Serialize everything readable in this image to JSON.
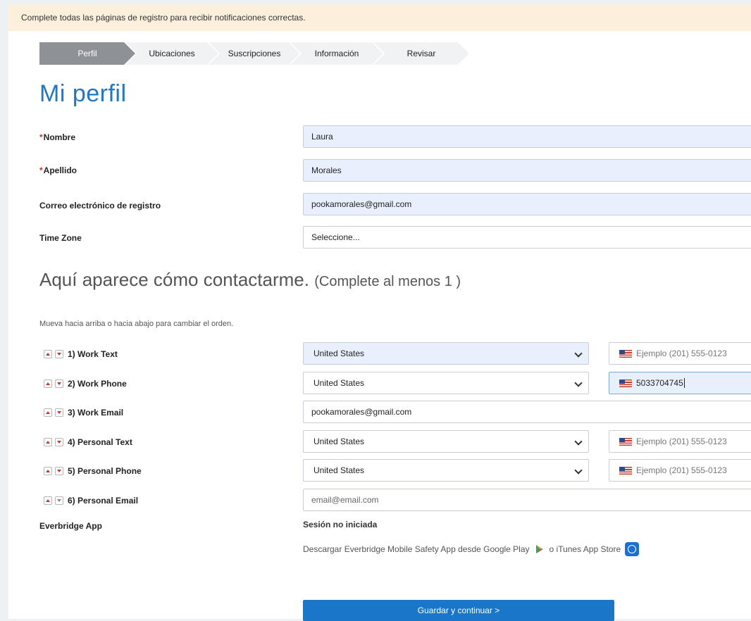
{
  "notice": "Complete todas las páginas de registro para recibir notificaciones correctas.",
  "steps": [
    {
      "label": "Perfil",
      "active": true
    },
    {
      "label": "Ubicaciones"
    },
    {
      "label": "Suscripciones"
    },
    {
      "label": "Información"
    },
    {
      "label": "Revisar"
    }
  ],
  "title": "Mi perfil",
  "profile": {
    "first_name_label": "Nombre",
    "first_name_value": "Laura",
    "last_name_label": "Apellido",
    "last_name_value": "Morales",
    "email_label": "Correo electrónico de registro",
    "email_value": "pookamorales@gmail.com",
    "timezone_label": "Time Zone",
    "timezone_value": "Seleccione..."
  },
  "contact": {
    "heading": "Aquí aparece cómo contactarme.",
    "heading_sub": "(Complete al menos 1 )",
    "hint": "Mueva hacia arriba o hacia abajo para cambiar el orden.",
    "rows": [
      {
        "label": "1) Work Text",
        "country": "United States",
        "phone_placeholder": "Ejemplo (201) 555-0123"
      },
      {
        "label": "2) Work Phone",
        "country": "United States",
        "phone_value": "5033704745"
      },
      {
        "label": "3) Work Email",
        "email_value": "pookamorales@gmail.com"
      },
      {
        "label": "4) Personal Text",
        "country": "United States",
        "phone_placeholder": "Ejemplo (201) 555-0123"
      },
      {
        "label": "5) Personal Phone",
        "country": "United States",
        "phone_placeholder": "Ejemplo (201) 555-0123"
      },
      {
        "label": "6) Personal Email",
        "email_placeholder": "email@email.com"
      }
    ]
  },
  "app": {
    "label": "Everbridge App",
    "status": "Sesión no iniciada",
    "download_text": "Descargar Everbridge Mobile Safety App desde Google Play",
    "or_text": "o iTunes App Store"
  },
  "save_button": "Guardar y continuar >",
  "icons": {
    "google_play": "google-play-icon",
    "app_store": "app-store-icon",
    "flag": "us-flag-icon"
  },
  "colors": {
    "accent": "#1976c8",
    "title": "#1e78c2",
    "notice_bg": "#fcefdc",
    "required": "#c0392b"
  }
}
